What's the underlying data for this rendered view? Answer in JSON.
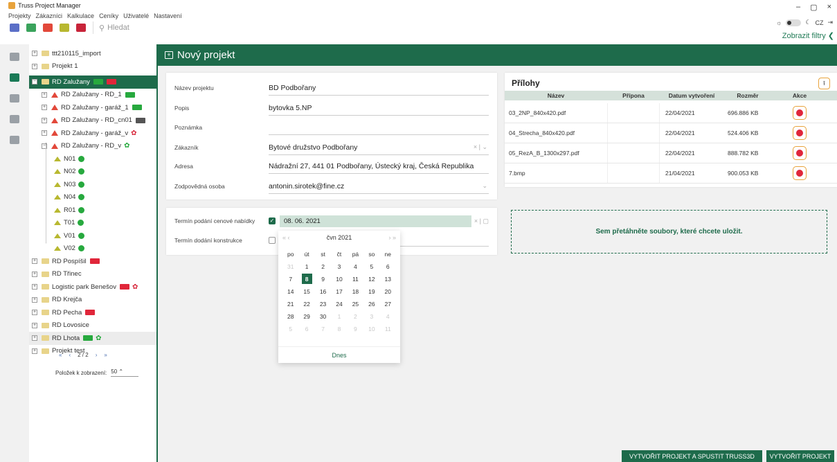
{
  "window": {
    "title": "Truss Project Manager",
    "controls": [
      "–",
      "▢",
      "×"
    ]
  },
  "menu": [
    "Projekty",
    "Zákazníci",
    "Kalkulace",
    "Ceníky",
    "Uživatelé",
    "Nastavení"
  ],
  "menu_right": {
    "lang": "CZ"
  },
  "toolbar": {
    "search_placeholder": "Hledat",
    "show_filters": "Zobrazit filtry"
  },
  "colors": {
    "accent": "#1e6b4b",
    "delete": "#e0263a",
    "highlight": "#e8a33c"
  },
  "tree": {
    "nodes": [
      {
        "label": "ttt210115_import",
        "kind": "folder"
      },
      {
        "label": "Projekt 1",
        "kind": "folder"
      },
      {
        "label": "RD Zalužany",
        "kind": "folder",
        "selected": true
      },
      {
        "label": "RD Zalužany - RD_1",
        "kind": "house"
      },
      {
        "label": "RD Zalužany - garáž_1",
        "kind": "house"
      },
      {
        "label": "RD Zalužany - RD_cn01",
        "kind": "house"
      },
      {
        "label": "RD Zalužany - garáž_v",
        "kind": "house"
      },
      {
        "label": "RD Zalužany - RD_v",
        "kind": "house"
      },
      {
        "label": "N01",
        "kind": "leaf"
      },
      {
        "label": "N02",
        "kind": "leaf"
      },
      {
        "label": "N03",
        "kind": "leaf"
      },
      {
        "label": "N04",
        "kind": "leaf"
      },
      {
        "label": "R01",
        "kind": "leaf"
      },
      {
        "label": "T01",
        "kind": "leaf"
      },
      {
        "label": "V01",
        "kind": "leaf"
      },
      {
        "label": "V02",
        "kind": "leaf"
      },
      {
        "label": "RD Pospíšil",
        "kind": "folder"
      },
      {
        "label": "RD Třinec",
        "kind": "folder"
      },
      {
        "label": "Logistic park Benešov",
        "kind": "folder"
      },
      {
        "label": "RD Krejča",
        "kind": "folder"
      },
      {
        "label": "RD Pecha",
        "kind": "folder"
      },
      {
        "label": "RD Lovosice",
        "kind": "folder"
      },
      {
        "label": "RD Lhota",
        "kind": "folder"
      },
      {
        "label": "Projekt test",
        "kind": "folder"
      }
    ],
    "pager": {
      "first": "«",
      "prev": "‹",
      "current": "2 / 2",
      "next": "›",
      "last": "»"
    },
    "per_page_label": "Položek k zobrazení:",
    "per_page_value": "50"
  },
  "header": {
    "title": "Nový projekt"
  },
  "form": {
    "fields": [
      {
        "label": "Název projektu",
        "value": "BD Podbořany"
      },
      {
        "label": "Popis",
        "value": "bytovka 5.NP"
      },
      {
        "label": "Poznámka",
        "value": ""
      },
      {
        "label": "Zákazník",
        "value": "Bytové družstvo Podbořany",
        "suffix": "× | ⌄"
      },
      {
        "label": "Adresa",
        "value": "Nádražní 27, 441 01 Podbořany, Ústecký kraj, Česká Republika"
      },
      {
        "label": "Zodpovědná osoba",
        "value": "antonin.sirotek@fine.cz",
        "suffix": "⌄"
      }
    ]
  },
  "dates": {
    "offer_label": "Termín podání cenové nabídky",
    "offer_value": "08. 06. 2021",
    "offer_suffix": "× | ▢",
    "delivery_label": "Termín dodání konstrukce"
  },
  "calendar": {
    "month": "čvn 2021",
    "prev": "« ‹",
    "next": "› »",
    "weekdays": [
      "po",
      "út",
      "st",
      "čt",
      "pá",
      "so",
      "ne"
    ],
    "days": [
      "31",
      "1",
      "2",
      "3",
      "4",
      "5",
      "6",
      "7",
      "8",
      "9",
      "10",
      "11",
      "12",
      "13",
      "14",
      "15",
      "16",
      "17",
      "18",
      "19",
      "20",
      "21",
      "22",
      "23",
      "24",
      "25",
      "26",
      "27",
      "28",
      "29",
      "30",
      "1",
      "2",
      "3",
      "4",
      "5",
      "6",
      "7",
      "8",
      "9",
      "10",
      "11"
    ],
    "today": "Dnes"
  },
  "attachments": {
    "title": "Přílohy",
    "columns": [
      "Název",
      "Přípona",
      "Datum vytvoření",
      "Rozměr",
      "Akce"
    ],
    "rows": [
      {
        "name": "03_2NP_840x420.pdf",
        "ext": "",
        "date": "22/04/2021",
        "size": "696.886 KB"
      },
      {
        "name": "04_Strecha_840x420.pdf",
        "ext": "",
        "date": "22/04/2021",
        "size": "524.406 KB"
      },
      {
        "name": "05_RezA_B_1300x297.pdf",
        "ext": "",
        "date": "22/04/2021",
        "size": "888.782 KB"
      },
      {
        "name": "7.bmp",
        "ext": "",
        "date": "21/04/2021",
        "size": "900.053 KB"
      }
    ]
  },
  "dropzone": {
    "text": "Sem přetáhněte soubory, které chcete uložit."
  },
  "buttons": {
    "create_and_run": "VYTVOŘIT PROJEKT A SPUSTIT TRUSS3D",
    "create": "VYTVOŘIT PROJEKT"
  }
}
